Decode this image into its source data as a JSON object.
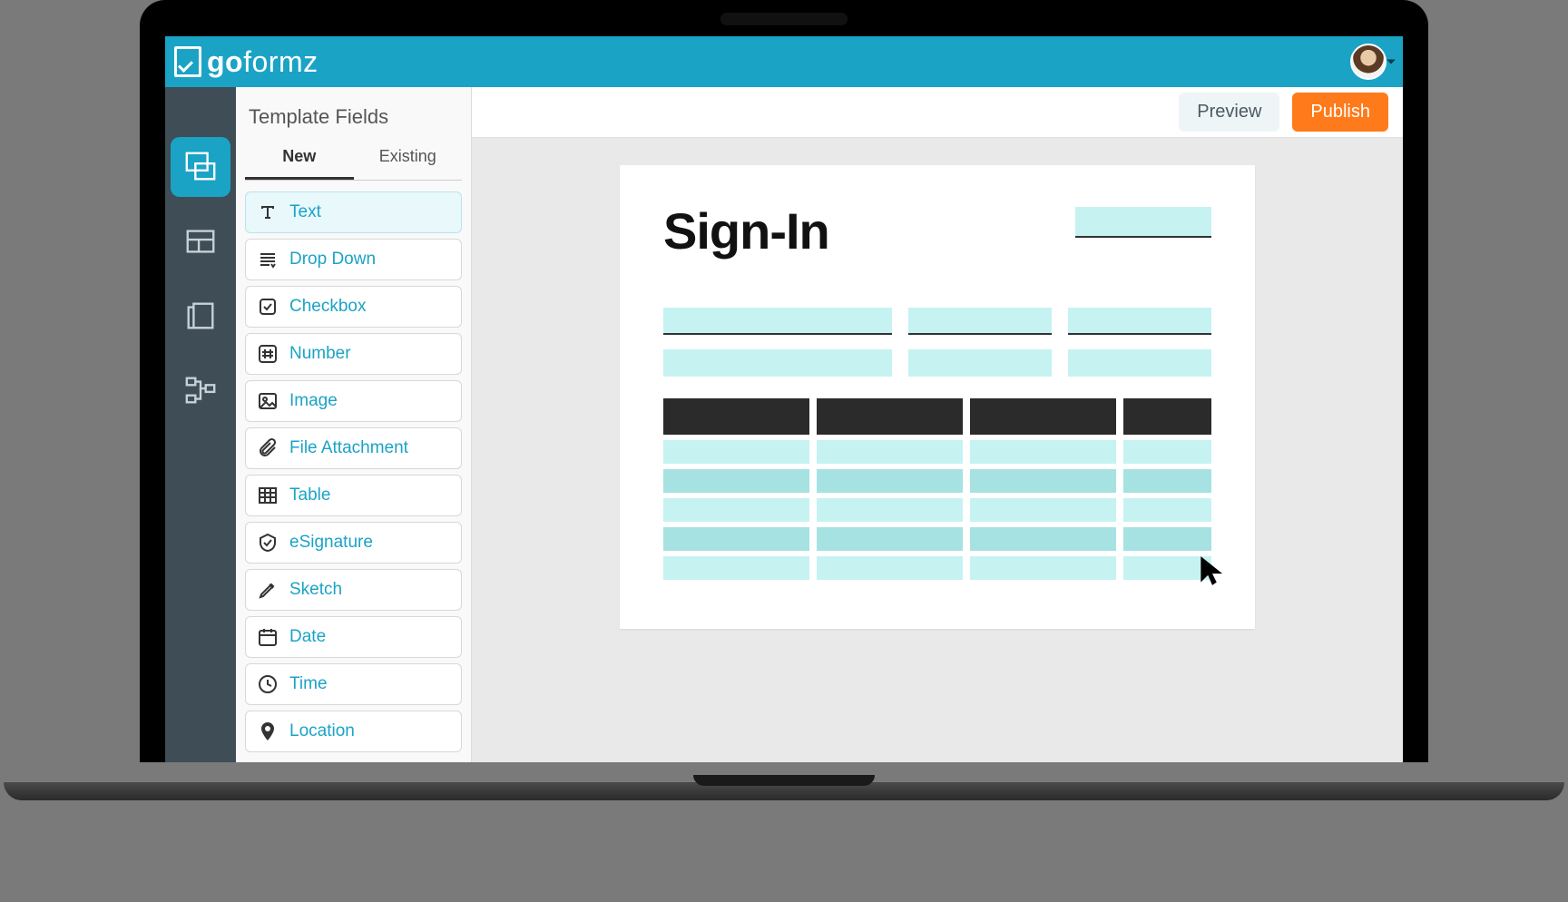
{
  "brand": {
    "prefix": "go",
    "suffix": "formz"
  },
  "actions": {
    "preview": "Preview",
    "publish": "Publish"
  },
  "panel": {
    "title": "Template Fields",
    "tabs": {
      "new": "New",
      "existing": "Existing"
    }
  },
  "fields": [
    {
      "icon": "text",
      "label": "Text",
      "selected": true
    },
    {
      "icon": "dropdown",
      "label": "Drop Down"
    },
    {
      "icon": "checkbox",
      "label": "Checkbox"
    },
    {
      "icon": "number",
      "label": "Number"
    },
    {
      "icon": "image",
      "label": "Image"
    },
    {
      "icon": "attachment",
      "label": "File Attachment"
    },
    {
      "icon": "table",
      "label": "Table"
    },
    {
      "icon": "esignature",
      "label": "eSignature"
    },
    {
      "icon": "sketch",
      "label": "Sketch"
    },
    {
      "icon": "date",
      "label": "Date"
    },
    {
      "icon": "time",
      "label": "Time"
    },
    {
      "icon": "location",
      "label": "Location"
    }
  ],
  "form": {
    "title": "Sign-In"
  },
  "rail": {
    "items": [
      "layout",
      "sections",
      "pages",
      "flow"
    ]
  }
}
